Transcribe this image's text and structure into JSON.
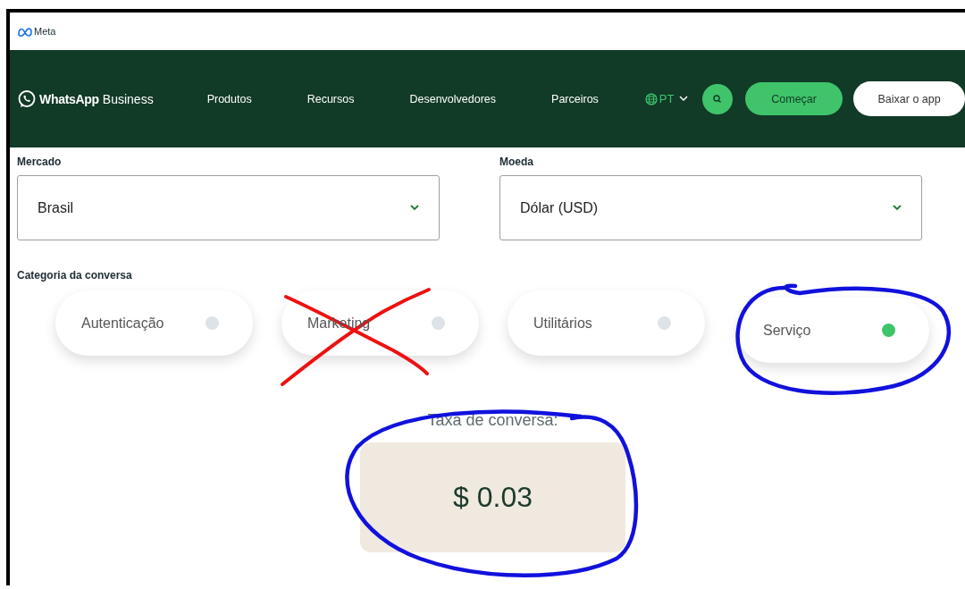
{
  "meta_bar": {
    "brand": "Meta"
  },
  "nav": {
    "brand_bold": "WhatsApp",
    "brand_light": "Business",
    "links": [
      "Produtos",
      "Recursos",
      "Desenvolvedores",
      "Parceiros"
    ],
    "language": "PT",
    "start_button": "Começar",
    "download_button": "Baixar o app"
  },
  "filters": [
    {
      "label": "Mercado",
      "value": "Brasil"
    },
    {
      "label": "Moeda",
      "value": "Dólar (USD)"
    }
  ],
  "category": {
    "label": "Categoria da conversa",
    "options": [
      {
        "label": "Autenticação",
        "selected": false
      },
      {
        "label": "Marketing",
        "selected": false
      },
      {
        "label": "Utilitários",
        "selected": false
      },
      {
        "label": "Serviço",
        "selected": true
      }
    ]
  },
  "rate": {
    "label": "Taxa de conversa:",
    "value": "$ 0.03"
  },
  "annotations": [
    {
      "kind": "cross",
      "color": "#ee1111"
    },
    {
      "kind": "circle",
      "color": "#1111dd"
    },
    {
      "kind": "circle",
      "color": "#1111dd"
    }
  ]
}
